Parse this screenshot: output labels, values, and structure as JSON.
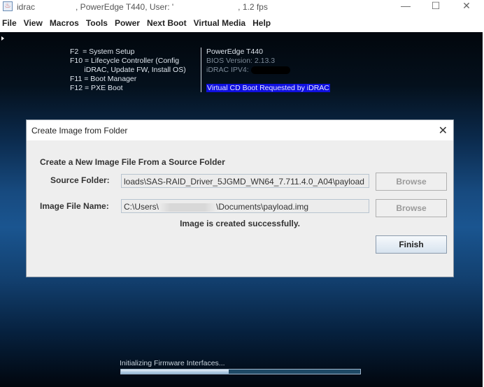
{
  "window": {
    "title_parts": [
      "idrac",
      ", PowerEdge T440, User: '",
      ", 1.2 fps"
    ],
    "minimize": "—",
    "maximize": "☐",
    "close": "✕"
  },
  "menu": [
    "File",
    "View",
    "Macros",
    "Tools",
    "Power",
    "Next Boot",
    "Virtual Media",
    "Help"
  ],
  "boot": {
    "left": [
      "F2  = System Setup",
      "F10 = Lifecycle Controller (Config",
      "       iDRAC, Update FW, Install OS)",
      "F11 = Boot Manager",
      "F12 = PXE Boot"
    ],
    "model": "PowerEdge T440",
    "bios": "BIOS Version: 2.13.3",
    "idrac_ip": "iDRAC IPV4:",
    "notice": "Virtual CD Boot Requested by iDRAC"
  },
  "dialog": {
    "title": "Create Image from Folder",
    "close": "✕",
    "heading": "Create a New Image File From a Source Folder",
    "source_label": "Source Folder:",
    "source_value": "loads\\SAS-RAID_Driver_5JGMD_WN64_7.711.4.0_A04\\payload",
    "image_label": "Image File Name:",
    "image_prefix": "C:\\Users\\",
    "image_suffix": "\\Documents\\payload.img",
    "browse": "Browse",
    "status": "Image is created successfully.",
    "finish": "Finish"
  },
  "progress": {
    "label": "Initializing Firmware Interfaces...",
    "percent": 45
  }
}
